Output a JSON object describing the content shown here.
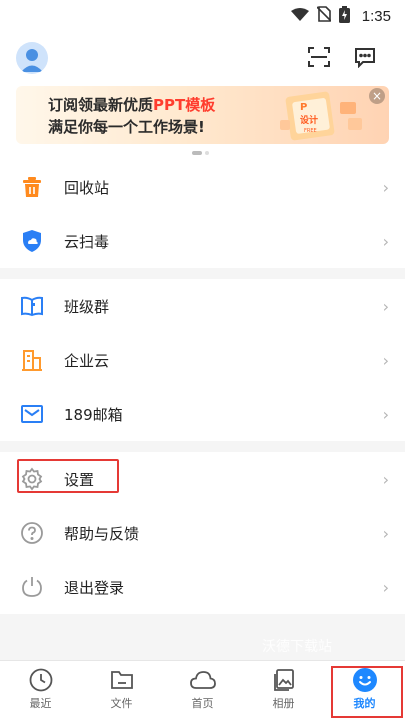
{
  "status": {
    "time": "1:35"
  },
  "banner": {
    "line1_prefix": "订阅领最新优质",
    "line1_highlight": "PPT模板",
    "line2": "满足你每一个工作场景!",
    "art_text": "设计",
    "art_sub": "FREE",
    "close": "×"
  },
  "menu_group1": [
    {
      "label": "回收站",
      "icon": "recycle-bin-icon"
    },
    {
      "label": "云扫毒",
      "icon": "shield-icon"
    }
  ],
  "menu_group2": [
    {
      "label": "班级群",
      "icon": "book-icon"
    },
    {
      "label": "企业云",
      "icon": "building-icon"
    },
    {
      "label": "189邮箱",
      "icon": "mail-icon"
    }
  ],
  "menu_group3": [
    {
      "label": "设置",
      "icon": "gear-icon"
    },
    {
      "label": "帮助与反馈",
      "icon": "help-icon"
    },
    {
      "label": "退出登录",
      "icon": "power-icon"
    }
  ],
  "chevron": "›",
  "watermark": "沃德下载站",
  "tabs": [
    {
      "label": "最近",
      "icon": "clock-icon"
    },
    {
      "label": "文件",
      "icon": "folder-icon"
    },
    {
      "label": "首页",
      "icon": "cloud-icon"
    },
    {
      "label": "相册",
      "icon": "album-icon"
    },
    {
      "label": "我的",
      "icon": "smiley-icon",
      "active": true
    }
  ],
  "colors": {
    "accent": "#1e88ff",
    "highlight_border": "#e53935",
    "banner_accent": "#ff3d2e"
  }
}
